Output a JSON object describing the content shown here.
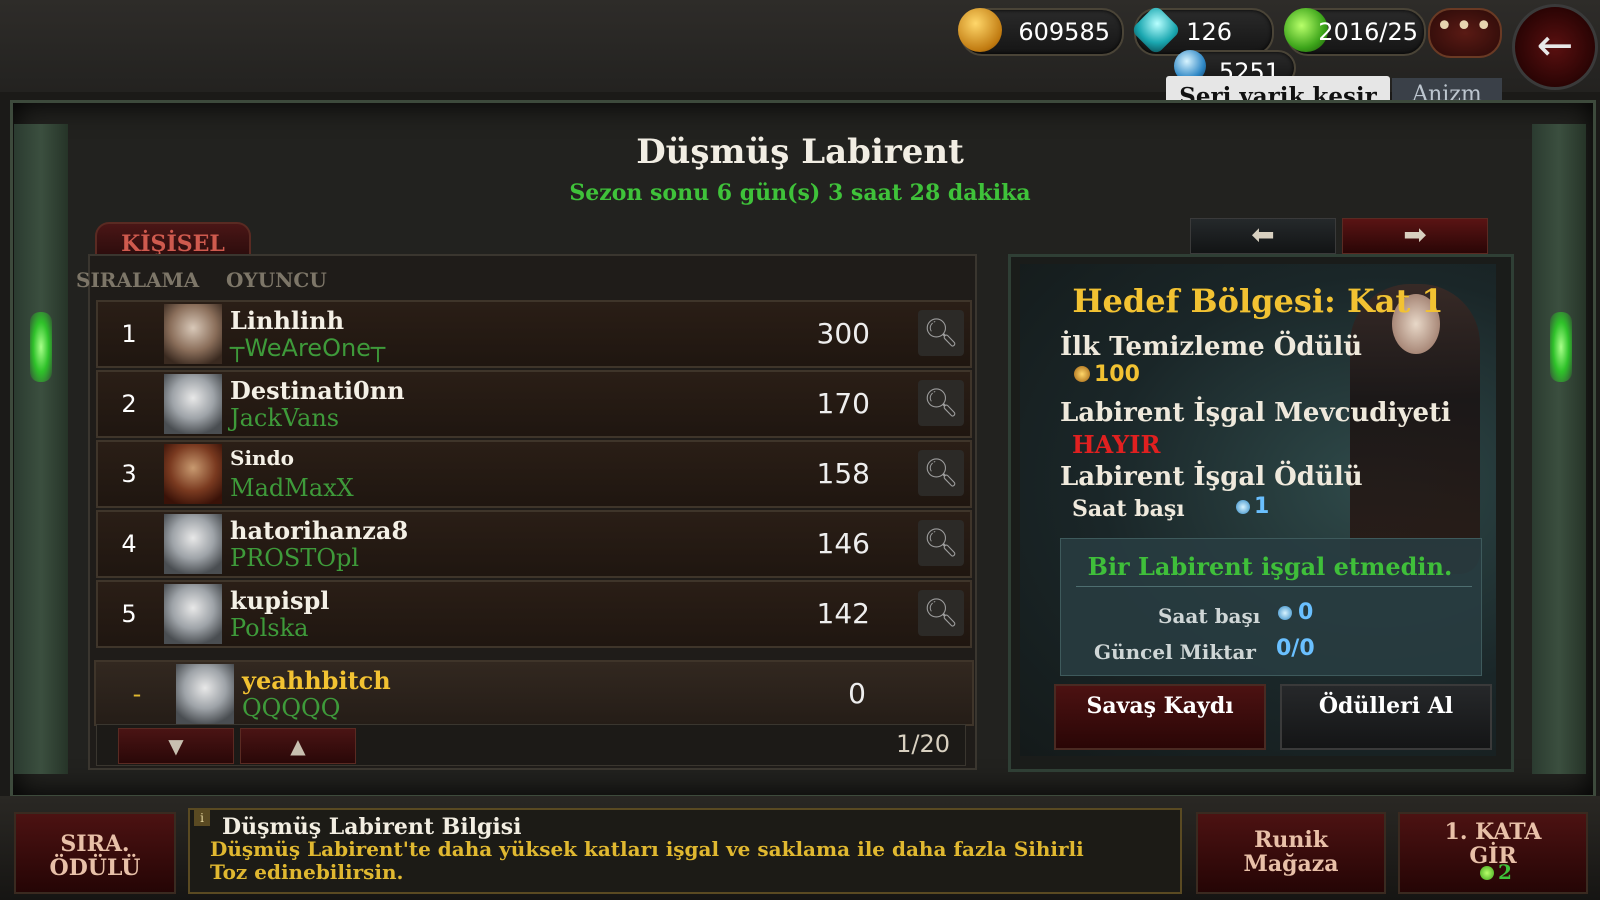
{
  "resources": {
    "gold": "609585",
    "gems": "126",
    "potions": "2016/25",
    "dust": "5251"
  },
  "tooltip": "Seri yarik kesir",
  "player_tag": "Anizm",
  "more_label": "•••",
  "back_label": "←",
  "title": "Düşmüş Labirent",
  "season": "Sezon sonu 6 gün(s) 3 saat 28 dakika",
  "tab_personal": "KİŞİSEL",
  "columns": {
    "rank": "SIRALAMA",
    "player": "OYUNCU"
  },
  "rankings": [
    {
      "rank": "1",
      "name": "Linhlinh",
      "guild": "┬WeAreOne┬",
      "score": "300"
    },
    {
      "rank": "2",
      "name": "Destinati0nn",
      "guild": "JackVans",
      "score": "170"
    },
    {
      "rank": "3",
      "name": "Sindo",
      "guild": "MadMaxX",
      "score": "158"
    },
    {
      "rank": "4",
      "name": "hatorihanza8",
      "guild": "PROSTOpl",
      "score": "146"
    },
    {
      "rank": "5",
      "name": "kupispl",
      "guild": "Polska",
      "score": "142"
    }
  ],
  "me": {
    "rank": "-",
    "name": "yeahhbitch",
    "guild": "QQQQQ",
    "score": "0"
  },
  "pager": {
    "down": "▼",
    "up": "▲",
    "page": "1/20"
  },
  "right": {
    "prev": "⬅",
    "next": "➡",
    "goal": "Hedef Bölgesi: Kat 1",
    "first_clear_label": "İlk Temizleme Ödülü",
    "first_clear_value": "100",
    "occupation_avail_label": "Labirent İşgal Mevcudiyeti",
    "occupation_avail_value": "HAYIR",
    "occupation_reward_label": "Labirent İşgal Ödülü",
    "per_hour_label": "Saat başı",
    "per_hour_value": "1",
    "not_occupied_msg": "Bir Labirent işgal etmedin.",
    "current_per_hour_label": "Saat başı",
    "current_per_hour_value": "0",
    "current_amount_label": "Güncel Miktar",
    "current_amount_value": "0/0",
    "battle_log_btn": "Savaş Kaydı",
    "collect_btn": "Ödülleri Al"
  },
  "bottom": {
    "rank_reward_btn": "SIRA. ÖDÜLÜ",
    "info_title": "Düşmüş Labirent Bilgisi",
    "info_text": "Düşmüş Labirent'te daha yüksek katları işgal ve saklama ile daha fazla Sihirli Toz edinebilirsin.",
    "rune_shop_btn": "Runik Mağaza",
    "enter_floor_btn": "1. KATA GİR",
    "enter_floor_count": "2"
  },
  "colors": {
    "accent_gold": "#f2c232",
    "guild_green": "#3e9a3a",
    "warning_red": "#e02020",
    "button_red": "#4c1212"
  }
}
